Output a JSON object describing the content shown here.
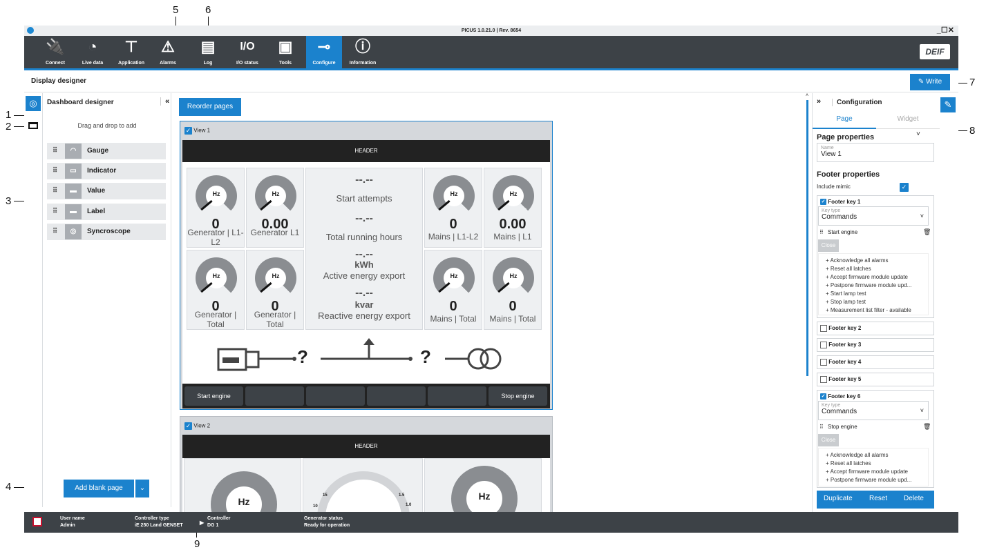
{
  "app": {
    "title": "PICUS 1.0.21.0 | Rev. 8654",
    "window_controls": "_☐✕",
    "brand": "DEIF"
  },
  "nav": {
    "items": [
      {
        "label": "Connect",
        "icon": "plug-icon",
        "glyph": "🔌"
      },
      {
        "label": "Live data",
        "icon": "speedometer-icon",
        "glyph": "◔"
      },
      {
        "label": "Application",
        "icon": "single-line-icon",
        "glyph": "⊤"
      },
      {
        "label": "Alarms",
        "icon": "warning-icon",
        "glyph": "⚠"
      },
      {
        "label": "Log",
        "icon": "log-icon",
        "glyph": "▤"
      },
      {
        "label": "I/O status",
        "icon": "io-icon",
        "glyph": "I/O"
      },
      {
        "label": "Tools",
        "icon": "toolbox-icon",
        "glyph": "▣"
      },
      {
        "label": "Configure",
        "icon": "wrench-icon",
        "glyph": "⊸"
      },
      {
        "label": "Information",
        "icon": "info-icon",
        "glyph": "ⓘ"
      }
    ],
    "active": "Configure"
  },
  "page": {
    "title": "Display designer",
    "write_label": "Write",
    "reorder_label": "Reorder pages"
  },
  "callouts": [
    "1",
    "2",
    "3",
    "4",
    "5",
    "6",
    "7",
    "8",
    "9"
  ],
  "dashboard": {
    "title": "Dashboard designer",
    "collapse": "«",
    "hint": "Drag and drop to add",
    "widgets": [
      {
        "label": "Gauge",
        "icon": "gauge-icon"
      },
      {
        "label": "Indicator",
        "icon": "indicator-icon"
      },
      {
        "label": "Value",
        "icon": "value-icon"
      },
      {
        "label": "Label",
        "icon": "label-icon"
      },
      {
        "label": "Syncroscope",
        "icon": "syncroscope-icon"
      }
    ],
    "add_blank_page": "Add blank page"
  },
  "view1": {
    "name": "View 1",
    "header": "HEADER",
    "gauges": [
      {
        "unit": "Hz",
        "value": "0",
        "label": "Generator | L1-L2"
      },
      {
        "unit": "Hz",
        "value": "0.00",
        "label": "Generator L1"
      },
      {
        "unit": "Hz",
        "value": "0",
        "label": "Mains | L1-L2"
      },
      {
        "unit": "Hz",
        "value": "0.00",
        "label": "Mains | L1"
      },
      {
        "unit": "Hz",
        "value": "0",
        "label": "Generator | Total"
      },
      {
        "unit": "Hz",
        "value": "0",
        "label": "Generator | Total"
      },
      {
        "unit": "Hz",
        "value": "0",
        "label": "Mains | Total"
      },
      {
        "unit": "Hz",
        "value": "0",
        "label": "Mains | Total"
      }
    ],
    "center": [
      {
        "value": "--.--",
        "unit": "",
        "label": "Start attempts"
      },
      {
        "value": "--.--",
        "unit": "",
        "label": "Total running hours"
      },
      {
        "value": "--.--",
        "unit": "kWh",
        "label": "Active energy export"
      },
      {
        "value": "--.--",
        "unit": "kvar",
        "label": "Reactive energy export"
      }
    ],
    "mimic": {
      "unknown1": "?",
      "unknown2": "?"
    },
    "footer_keys": [
      "Start engine",
      "",
      "",
      "",
      "",
      "Stop engine"
    ]
  },
  "view2": {
    "name": "View 2",
    "header": "HEADER",
    "gauge_unit": "Hz",
    "sync_ticks": [
      "15",
      "10",
      "1.5",
      "1.0"
    ]
  },
  "config": {
    "title": "Configuration",
    "expand": "»",
    "tabs": [
      "Page",
      "Widget"
    ],
    "page_properties": "Page properties",
    "name_label": "Name",
    "name_value": "View 1",
    "footer_properties": "Footer properties",
    "include_mimic": "Include mimic",
    "footer_key_1": "Footer key 1",
    "footer_key_6": "Footer key 6",
    "key_type_label": "Key type",
    "key_type_value": "Commands",
    "fk1_command": "Start engine",
    "fk6_command": "Stop engine",
    "close_label": "Close",
    "commands_1": [
      "+ Acknowledge all alarms",
      "+ Reset all latches",
      "+ Accept firmware module update",
      "+ Postpone firmware module upd...",
      "+ Start lamp test",
      "+ Stop lamp test",
      "+ Measurement list filter - available"
    ],
    "commands_6": [
      "+ Acknowledge all alarms",
      "+ Reset all latches",
      "+ Accept firmware module update",
      "+ Postpone firmware module upd..."
    ],
    "footer_keys_unchecked": [
      "Footer key 2",
      "Footer key 3",
      "Footer key 4",
      "Footer key 5"
    ],
    "actions": [
      "Duplicate",
      "Reset",
      "Delete"
    ]
  },
  "status": {
    "user_label": "User name",
    "user_value": "Admin",
    "ctype_label": "Controller type",
    "ctype_value": "iE 250 Land GENSET",
    "ctrl_label": "Controller",
    "ctrl_value": "DG 1",
    "gen_label": "Generator status",
    "gen_value": "Ready for operation"
  },
  "colors": {
    "accent": "#1b82cd",
    "nav_bg": "#3d4247",
    "view_header": "#222222"
  }
}
